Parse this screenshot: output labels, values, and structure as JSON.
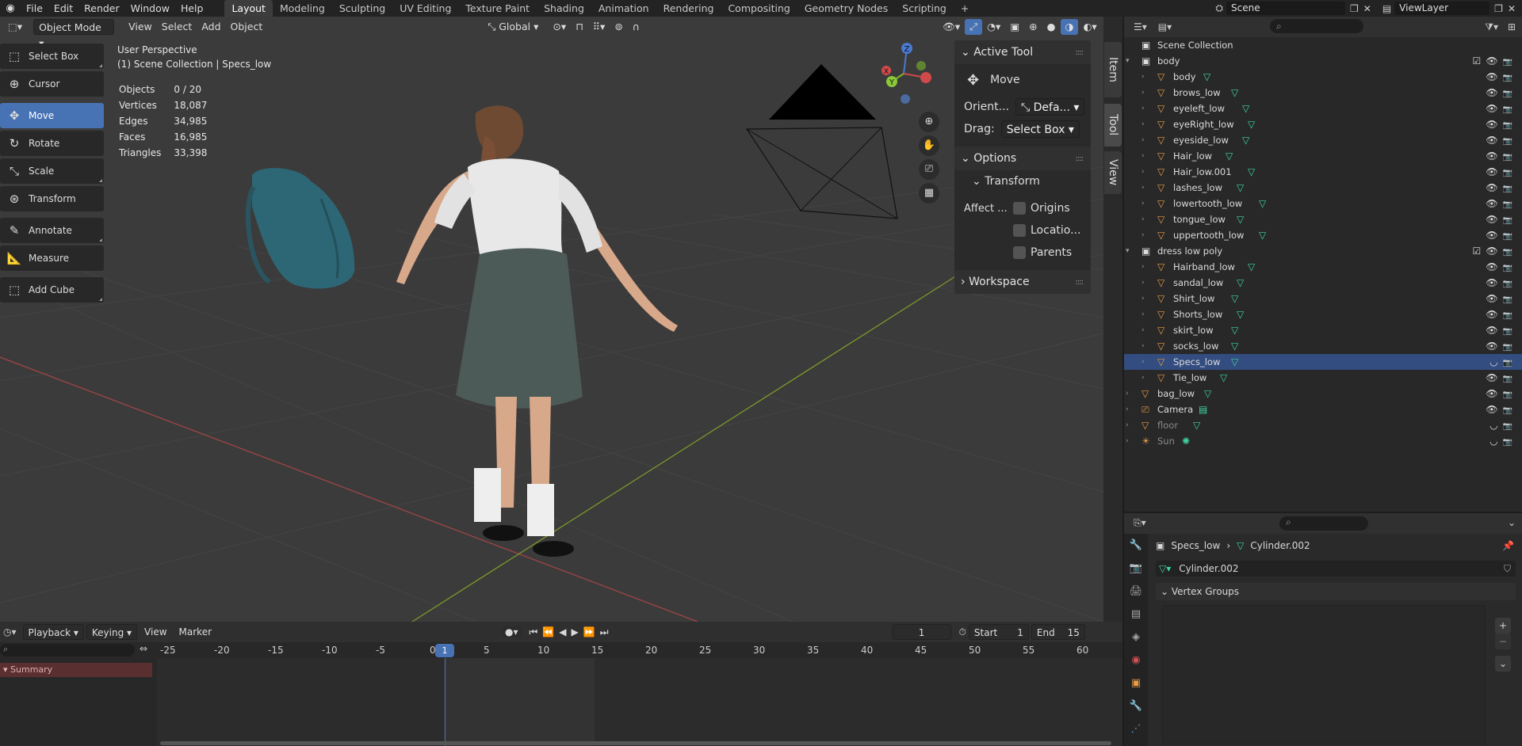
{
  "menus": [
    "File",
    "Edit",
    "Render",
    "Window",
    "Help"
  ],
  "workspaces": [
    "Layout",
    "Modeling",
    "Sculpting",
    "UV Editing",
    "Texture Paint",
    "Shading",
    "Animation",
    "Rendering",
    "Compositing",
    "Geometry Nodes",
    "Scripting",
    "+"
  ],
  "scene_name": "Scene",
  "view_layer": "ViewLayer",
  "viewport": {
    "mode": "Object Mode",
    "menus": [
      "View",
      "Select",
      "Add",
      "Object"
    ],
    "transform_orientation": "Global",
    "view_name": "User Perspective",
    "collection_info": "(1) Scene Collection | Specs_low",
    "stats": [
      {
        "label": "Objects",
        "value": "0 / 20"
      },
      {
        "label": "Vertices",
        "value": "18,087"
      },
      {
        "label": "Edges",
        "value": "34,985"
      },
      {
        "label": "Faces",
        "value": "16,985"
      },
      {
        "label": "Triangles",
        "value": "33,398"
      }
    ],
    "tools": [
      "Select Box",
      "Cursor",
      "Move",
      "Rotate",
      "Scale",
      "Transform",
      "Annotate",
      "Measure",
      "Add Cube"
    ],
    "active_tool": "Move"
  },
  "npanel": {
    "active_tool_label": "Active Tool",
    "tool_name": "Move",
    "orient_label": "Orient...",
    "orient_value": "Defa...",
    "drag_label": "Drag:",
    "drag_value": "Select Box",
    "options_label": "Options",
    "transform_label": "Transform",
    "affect_label": "Affect ...",
    "affect_opts": [
      "Origins",
      "Locatio...",
      "Parents"
    ],
    "workspace_label": "Workspace",
    "tabs": [
      "Item",
      "Tool",
      "View"
    ]
  },
  "outliner": {
    "search_placeholder": "",
    "root": "Scene Collection",
    "rows": [
      {
        "name": "body",
        "type": "collection",
        "indent": 1
      },
      {
        "name": "body",
        "type": "mesh",
        "indent": 2
      },
      {
        "name": "brows_low",
        "type": "mesh",
        "indent": 2
      },
      {
        "name": "eyeleft_low",
        "type": "mesh",
        "indent": 2
      },
      {
        "name": "eyeRight_low",
        "type": "mesh",
        "indent": 2
      },
      {
        "name": "eyeside_low",
        "type": "mesh",
        "indent": 2
      },
      {
        "name": "Hair_low",
        "type": "mesh",
        "indent": 2
      },
      {
        "name": "Hair_low.001",
        "type": "mesh",
        "indent": 2
      },
      {
        "name": "lashes_low",
        "type": "mesh",
        "indent": 2
      },
      {
        "name": "lowertooth_low",
        "type": "mesh",
        "indent": 2
      },
      {
        "name": "tongue_low",
        "type": "mesh",
        "indent": 2
      },
      {
        "name": "uppertooth_low",
        "type": "mesh",
        "indent": 2
      },
      {
        "name": "dress low poly",
        "type": "collection",
        "indent": 1
      },
      {
        "name": "Hairband_low",
        "type": "mesh",
        "indent": 2
      },
      {
        "name": "sandal_low",
        "type": "mesh",
        "indent": 2
      },
      {
        "name": "Shirt_low",
        "type": "mesh",
        "indent": 2
      },
      {
        "name": "Shorts_low",
        "type": "mesh",
        "indent": 2
      },
      {
        "name": "skirt_low",
        "type": "mesh",
        "indent": 2
      },
      {
        "name": "socks_low",
        "type": "mesh",
        "indent": 2
      },
      {
        "name": "Specs_low",
        "type": "mesh",
        "indent": 2,
        "selected": true
      },
      {
        "name": "Tie_low",
        "type": "mesh",
        "indent": 2
      },
      {
        "name": "bag_low",
        "type": "mesh",
        "indent": 1
      },
      {
        "name": "Camera",
        "type": "camera",
        "indent": 1
      },
      {
        "name": "floor",
        "type": "mesh",
        "indent": 1,
        "dim": true
      },
      {
        "name": "Sun",
        "type": "light",
        "indent": 1,
        "dim": true
      }
    ]
  },
  "properties": {
    "breadcrumb_object": "Specs_low",
    "breadcrumb_data": "Cylinder.002",
    "data_name": "Cylinder.002",
    "section": "Vertex Groups"
  },
  "timeline": {
    "menus": [
      "Playback",
      "Keying",
      "View",
      "Marker"
    ],
    "current_frame": "1",
    "start_label": "Start",
    "start": "1",
    "end_label": "End",
    "end": "15",
    "ruler": [
      "-25",
      "-20",
      "-15",
      "-10",
      "-5",
      "0",
      "5",
      "10",
      "15",
      "20",
      "25",
      "30",
      "35",
      "40",
      "45",
      "50",
      "55",
      "60"
    ],
    "summary_label": "Summary"
  }
}
